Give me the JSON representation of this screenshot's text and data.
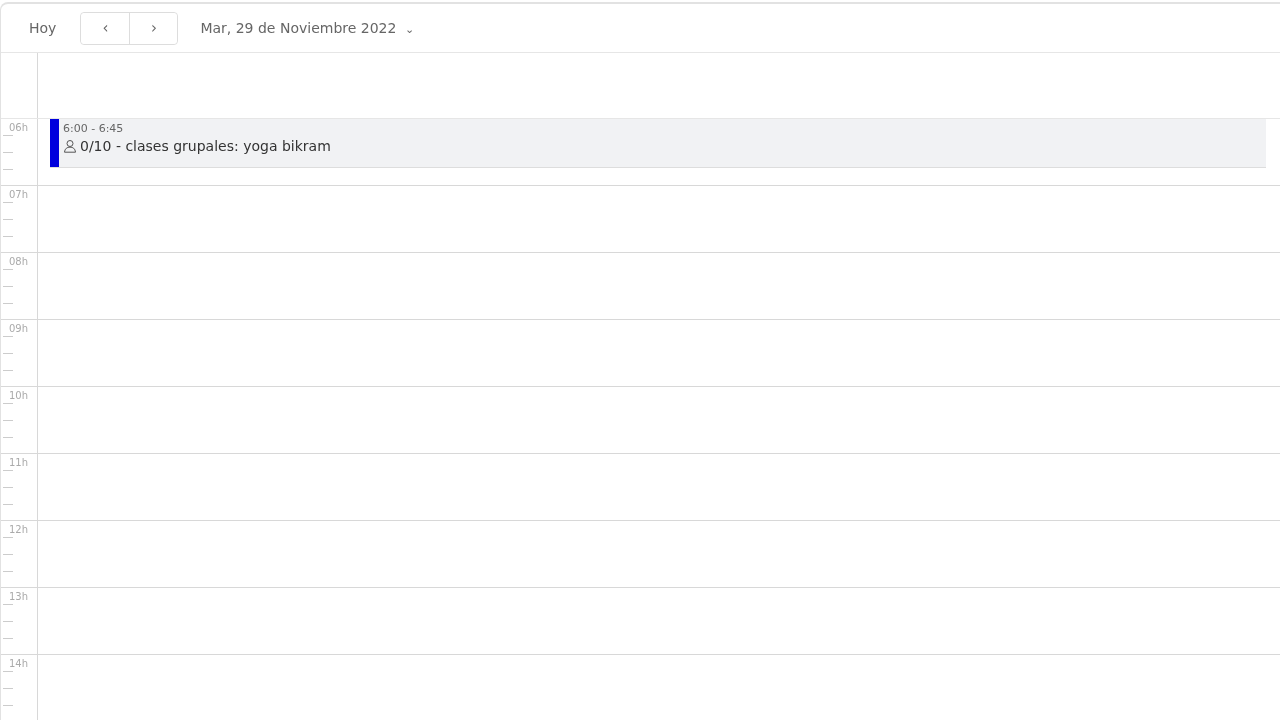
{
  "toolbar": {
    "today": "Hoy",
    "prev": "‹",
    "next": "›",
    "date": "Mar, 29 de Noviembre 2022",
    "caret": "⌄"
  },
  "hours": [
    {
      "label": "06h",
      "events": [
        {
          "time": "6:00 - 6:45",
          "title": "0/10 - clases grupales: yoga bikram",
          "color": "#0000dd"
        }
      ]
    },
    {
      "label": "07h"
    },
    {
      "label": "08h"
    },
    {
      "label": "09h"
    },
    {
      "label": "10h"
    },
    {
      "label": "11h"
    },
    {
      "label": "12h"
    },
    {
      "label": "13h"
    },
    {
      "label": "14h"
    }
  ]
}
